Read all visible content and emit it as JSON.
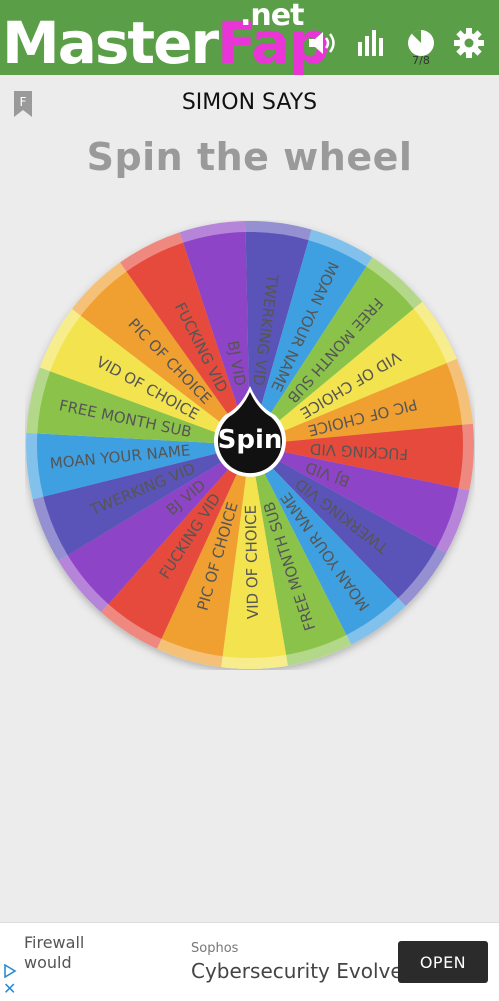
{
  "header": {
    "logo_white": "Master",
    "logo_pink": "Fap",
    "logo_net": ".net",
    "progress_label": "7/8",
    "progress_fraction": 0.875,
    "icons": [
      "sound-icon",
      "bar-chart-icon",
      "pie-progress-icon",
      "gear-icon"
    ],
    "bg_color": "#5a9e48"
  },
  "game": {
    "bookmark_letter": "F",
    "title": "SIMON SAYS",
    "heading": "Spin the wheel",
    "spin_label": "Spin"
  },
  "wheel": {
    "segments": [
      {
        "label": "BJ VID",
        "color": "#8e44c6"
      },
      {
        "label": "TWERKING VID",
        "color": "#5b54b8"
      },
      {
        "label": "MOAN YOUR NAME",
        "color": "#3ea0e0"
      },
      {
        "label": "FREE MONTH SUB",
        "color": "#8bc34a"
      },
      {
        "label": "VID OF CHOICE",
        "color": "#f2e34f"
      },
      {
        "label": "PIC OF CHOICE",
        "color": "#f0a030"
      },
      {
        "label": "FUCKING VID",
        "color": "#e64a3c"
      },
      {
        "label": "BJ VID",
        "color": "#8e44c6"
      },
      {
        "label": "TWERKING VID",
        "color": "#5b54b8"
      },
      {
        "label": "MOAN YOUR NAME",
        "color": "#3ea0e0"
      },
      {
        "label": "FREE MONTH SUB",
        "color": "#8bc34a"
      },
      {
        "label": "VID OF CHOICE",
        "color": "#f2e34f"
      },
      {
        "label": "PIC OF CHOICE",
        "color": "#f0a030"
      },
      {
        "label": "FUCKING VID",
        "color": "#e64a3c"
      },
      {
        "label": "BJ VID",
        "color": "#8e44c6"
      },
      {
        "label": "TWERKING VID",
        "color": "#5b54b8"
      },
      {
        "label": "MOAN YOUR NAME",
        "color": "#3ea0e0"
      },
      {
        "label": "FREE MONTH SUB",
        "color": "#8bc34a"
      },
      {
        "label": "VID OF CHOICE",
        "color": "#f2e34f"
      },
      {
        "label": "PIC OF CHOICE",
        "color": "#f0a030"
      },
      {
        "label": "FUCKING VID",
        "color": "#e64a3c"
      }
    ]
  },
  "ad": {
    "left_text_line1": "Firewall",
    "left_text_line2": "would",
    "brand": "Sophos",
    "headline": "Cybersecurity Evolved",
    "cta": "OPEN"
  }
}
